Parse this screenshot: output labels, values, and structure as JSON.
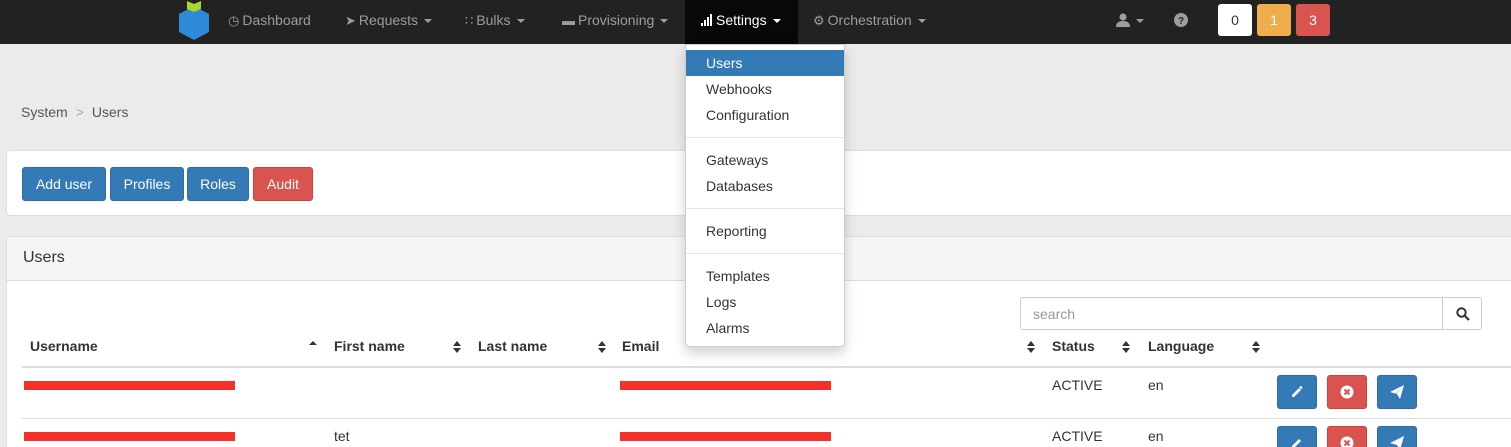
{
  "navbar": {
    "items": [
      {
        "label": "Dashboard",
        "icon": "clock-icon"
      },
      {
        "label": "Requests",
        "icon": "paper-plane-icon"
      },
      {
        "label": "Bulks",
        "icon": "sitemap-icon"
      },
      {
        "label": "Provisioning",
        "icon": "hdd-icon"
      },
      {
        "label": "Settings",
        "icon": "signal-icon"
      },
      {
        "label": "Orchestration",
        "icon": "gear-icon"
      }
    ],
    "badges": [
      "0",
      "1",
      "3"
    ],
    "colors": {
      "background": "#222222",
      "active": "#080808",
      "badge_warning": "#f0ad4e",
      "badge_danger": "#d9534f"
    }
  },
  "settings_menu": {
    "items": [
      "Users",
      "Webhooks",
      "Configuration",
      "Gateways",
      "Databases",
      "Reporting",
      "Templates",
      "Logs",
      "Alarms"
    ],
    "active": "Users"
  },
  "breadcrumb": {
    "root": "System",
    "separator": ">",
    "current": "Users"
  },
  "toolbar": {
    "add_user": "Add user",
    "profiles": "Profiles",
    "roles": "Roles",
    "audit": "Audit"
  },
  "users": {
    "title": "Users",
    "search_placeholder": "search",
    "columns": [
      "Username",
      "First name",
      "Last name",
      "Email",
      "Status",
      "Language"
    ],
    "rows": [
      {
        "first_name": "",
        "last_name": "",
        "status": "ACTIVE",
        "language": "en"
      },
      {
        "first_name": "tet",
        "last_name": "",
        "status": "ACTIVE",
        "language": "en"
      }
    ]
  },
  "colors": {
    "primary": "#337ab7",
    "danger": "#d9534f",
    "redaction": "#f5302b"
  }
}
